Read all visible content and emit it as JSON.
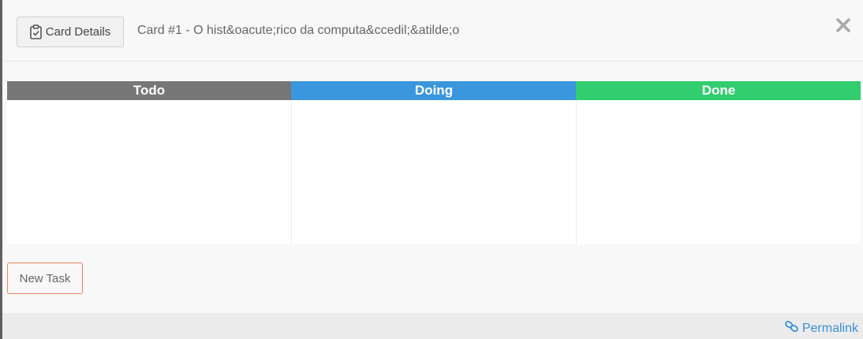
{
  "header": {
    "card_details_label": "Card Details",
    "card_title": "Card #1 - O hist&oacute;rico da computa&ccedil;&atilde;o"
  },
  "board": {
    "columns": [
      {
        "label": "Todo",
        "color": "#777777"
      },
      {
        "label": "Doing",
        "color": "#3a97dd"
      },
      {
        "label": "Done",
        "color": "#32cd6e"
      }
    ]
  },
  "actions": {
    "new_task_label": "New Task"
  },
  "footer": {
    "permalink_label": "Permalink"
  },
  "icons": {
    "card_details": "clipboard-check-icon",
    "close": "close-icon",
    "permalink": "link-icon"
  },
  "colors": {
    "new_task_border": "#e8835f",
    "link": "#3a8fd8"
  }
}
